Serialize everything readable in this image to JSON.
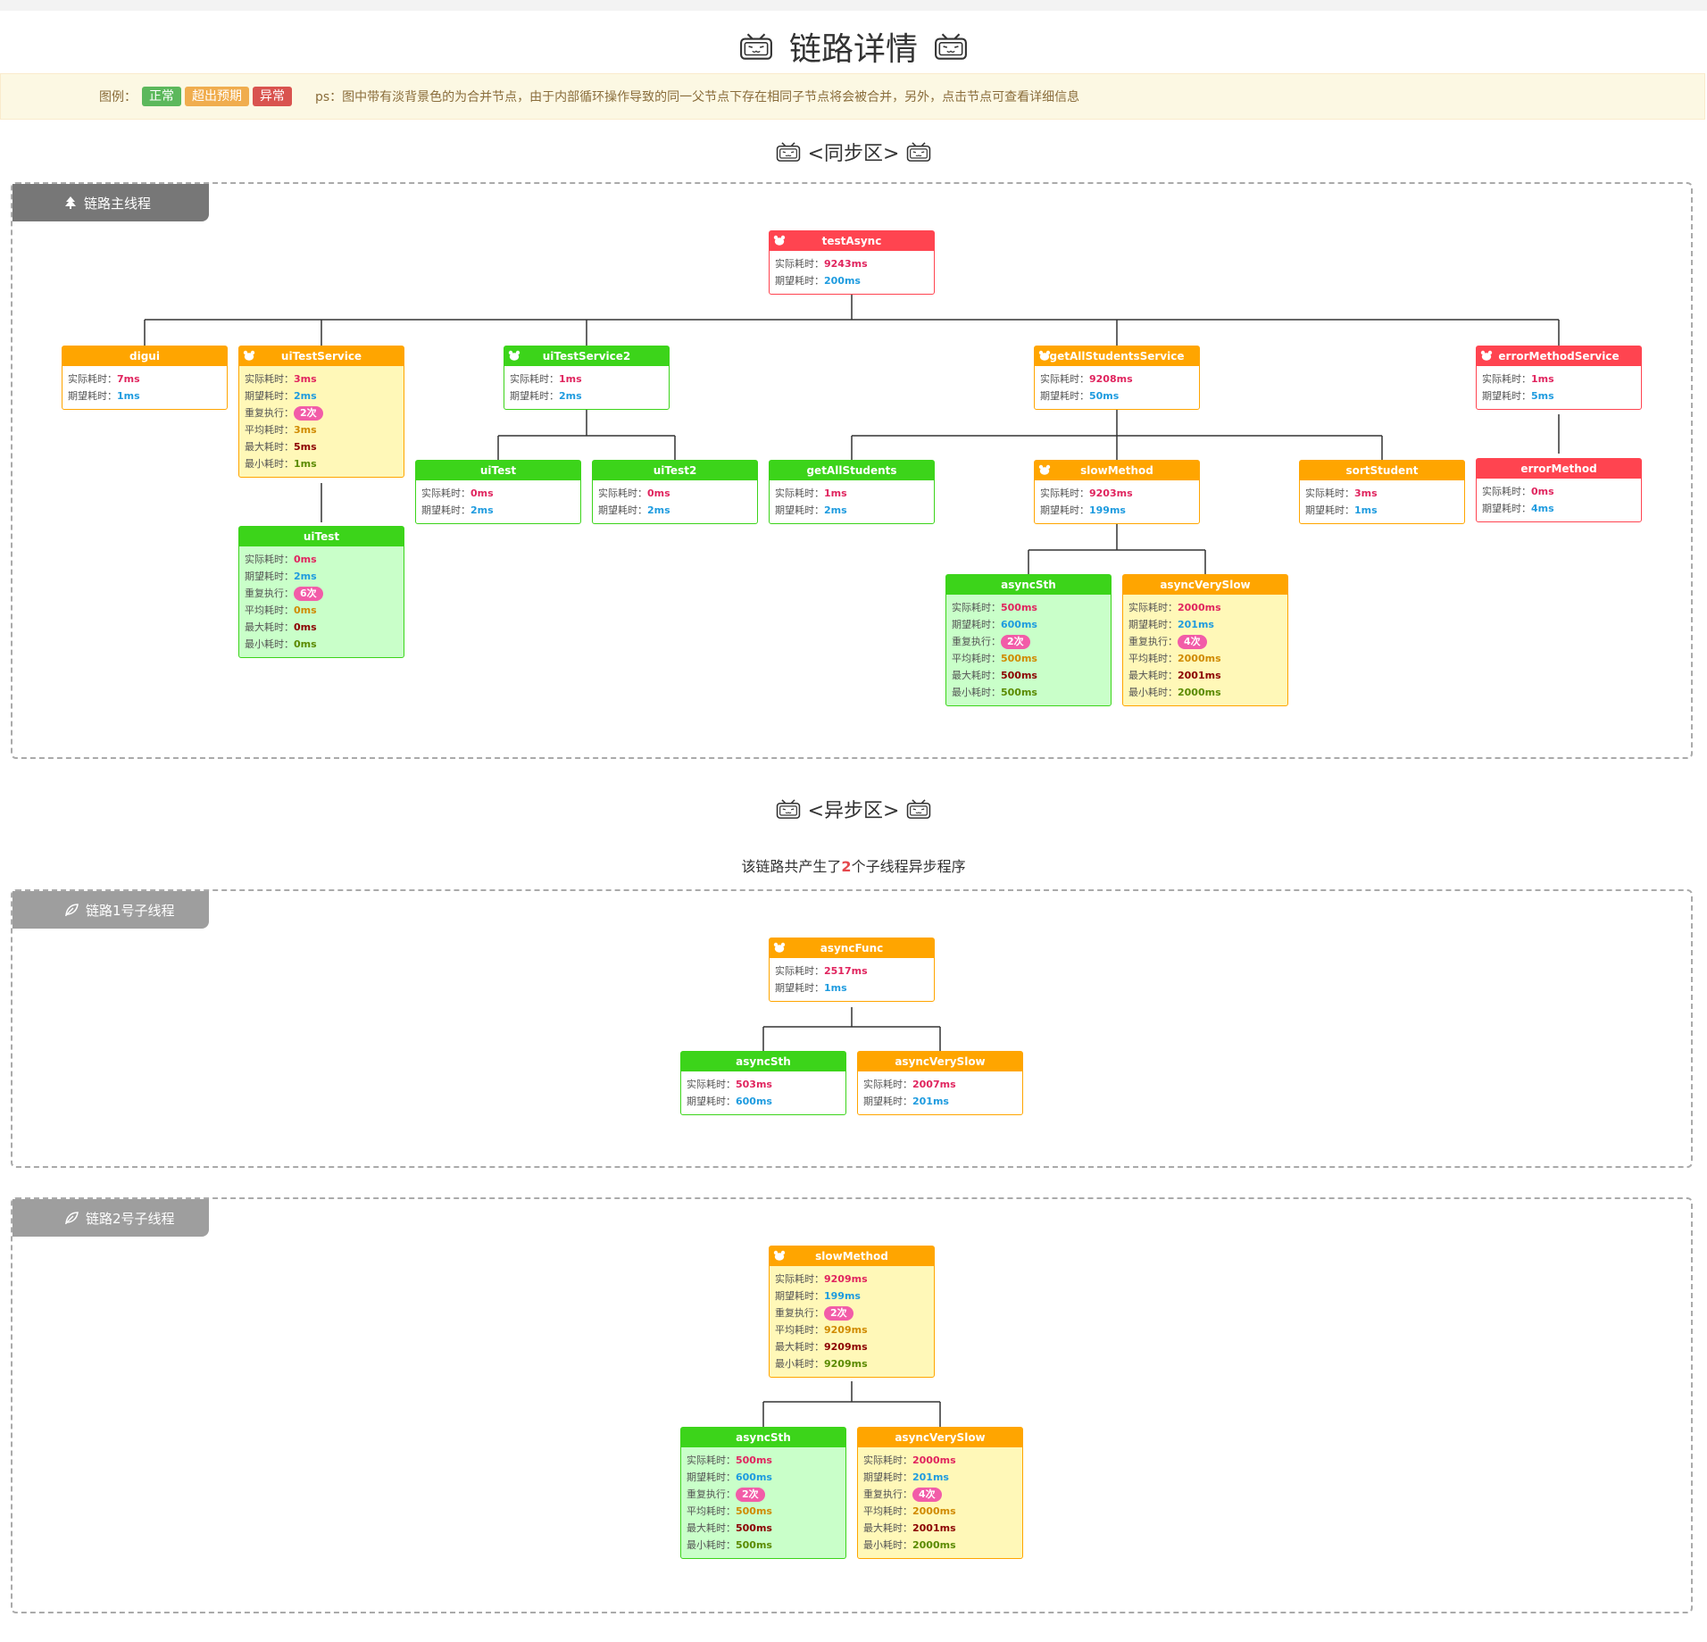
{
  "page_title": "链路详情",
  "legend": {
    "label": "图例：",
    "items": [
      {
        "label": "正常",
        "color": "#5cb85c"
      },
      {
        "label": "超出预期",
        "color": "#f0ad4e"
      },
      {
        "label": "异常",
        "color": "#d9534f"
      }
    ],
    "note": "ps：图中带有淡背景色的为合并节点，由于内部循环操作导致的同一父节点下存在相同子节点将会被合并，另外，点击节点可查看详细信息"
  },
  "sync": {
    "title": "<同步区>",
    "tab_label": "链路主线程"
  },
  "async": {
    "title": "<异步区>",
    "note_prefix": "该链路共产生了",
    "note_count": "2",
    "note_suffix": "个子线程异步程序",
    "thread1_label": "链路1号子线程",
    "thread2_label": "链路2号子线程"
  },
  "labels": {
    "actual": "实际耗时：",
    "expect": "期望耗时：",
    "repeat": "重复执行：",
    "avg": "平均耗时：",
    "max": "最大耗时：",
    "min": "最小耗时："
  },
  "colors": {
    "normal": "#3cd41a",
    "exceed": "#ffa500",
    "error": "#ff4450"
  },
  "nodes": {
    "testAsync": {
      "name": "testAsync",
      "actual": "9243ms",
      "expect": "200ms"
    },
    "digui": {
      "name": "digui",
      "actual": "7ms",
      "expect": "1ms"
    },
    "uiTestService": {
      "name": "uiTestService",
      "actual": "3ms",
      "expect": "2ms",
      "repeat": "2次",
      "avg": "3ms",
      "max": "5ms",
      "min": "1ms"
    },
    "uiTestService2": {
      "name": "uiTestService2",
      "actual": "1ms",
      "expect": "2ms"
    },
    "getAllStudentsService": {
      "name": "getAllStudentsService",
      "actual": "9208ms",
      "expect": "50ms"
    },
    "errorMethodService": {
      "name": "errorMethodService",
      "actual": "1ms",
      "expect": "5ms"
    },
    "uiTest": {
      "name": "uiTest",
      "actual": "0ms",
      "expect": "2ms",
      "repeat": "6次",
      "avg": "0ms",
      "max": "0ms",
      "min": "0ms"
    },
    "uiTest1": {
      "name": "uiTest",
      "actual": "0ms",
      "expect": "2ms"
    },
    "uiTest2": {
      "name": "uiTest2",
      "actual": "0ms",
      "expect": "2ms"
    },
    "getAllStudents": {
      "name": "getAllStudents",
      "actual": "1ms",
      "expect": "2ms"
    },
    "slowMethod": {
      "name": "slowMethod",
      "actual": "9203ms",
      "expect": "199ms"
    },
    "sortStudent": {
      "name": "sortStudent",
      "actual": "3ms",
      "expect": "1ms"
    },
    "errorMethod": {
      "name": "errorMethod",
      "actual": "0ms",
      "expect": "4ms"
    },
    "asyncSth": {
      "name": "asyncSth",
      "actual": "500ms",
      "expect": "600ms",
      "repeat": "2次",
      "avg": "500ms",
      "max": "500ms",
      "min": "500ms"
    },
    "asyncVerySlow": {
      "name": "asyncVerySlow",
      "actual": "2000ms",
      "expect": "201ms",
      "repeat": "4次",
      "avg": "2000ms",
      "max": "2001ms",
      "min": "2000ms"
    },
    "t1_asyncFunc": {
      "name": "asyncFunc",
      "actual": "2517ms",
      "expect": "1ms"
    },
    "t1_asyncSth": {
      "name": "asyncSth",
      "actual": "503ms",
      "expect": "600ms"
    },
    "t1_asyncVerySlow": {
      "name": "asyncVerySlow",
      "actual": "2007ms",
      "expect": "201ms"
    },
    "t2_slowMethod": {
      "name": "slowMethod",
      "actual": "9209ms",
      "expect": "199ms",
      "repeat": "2次",
      "avg": "9209ms",
      "max": "9209ms",
      "min": "9209ms"
    },
    "t2_asyncSth": {
      "name": "asyncSth",
      "actual": "500ms",
      "expect": "600ms",
      "repeat": "2次",
      "avg": "500ms",
      "max": "500ms",
      "min": "500ms"
    },
    "t2_asyncVerySlow": {
      "name": "asyncVerySlow",
      "actual": "2000ms",
      "expect": "201ms",
      "repeat": "4次",
      "avg": "2000ms",
      "max": "2001ms",
      "min": "2000ms"
    }
  }
}
